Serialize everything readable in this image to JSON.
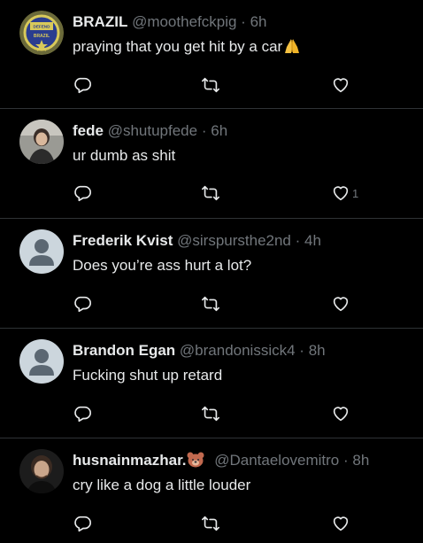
{
  "tweets": [
    {
      "name": "BRAZIL",
      "handle": "@moothefckpig",
      "time": "6h",
      "text": "praying that you get hit by a car",
      "text_emoji": "praying-hands",
      "avatar": "badge-avatar",
      "avatar_text": "DEFEND BRAZIL"
    },
    {
      "name": "fede",
      "handle": "@shutupfede",
      "time": "6h",
      "text": "ur dumb as shit",
      "avatar": "photo-avatar",
      "likes": "1"
    },
    {
      "name": "Frederik Kvist",
      "handle": "@sirspursthe2nd",
      "time": "4h",
      "text": "Does you’re ass hurt a lot?",
      "avatar": "default-avatar"
    },
    {
      "name": "Brandon Egan",
      "handle": "@brandonissick4",
      "time": "8h",
      "text": "Fucking shut up retard",
      "avatar": "default-avatar"
    },
    {
      "name": "husnainmazhar.",
      "name_emoji": "bear-face",
      "handle": "@Dantaelovemitro",
      "time": "8h",
      "text": "cry like a dog a little louder",
      "avatar": "photo-avatar"
    }
  ],
  "sep": "·",
  "colors": {
    "background": "#000000",
    "text": "#e7e9ea",
    "muted": "#71767b",
    "divider": "#2f3336"
  },
  "icons": {
    "reply": "reply-icon",
    "retweet": "retweet-icon",
    "like": "heart-icon"
  }
}
